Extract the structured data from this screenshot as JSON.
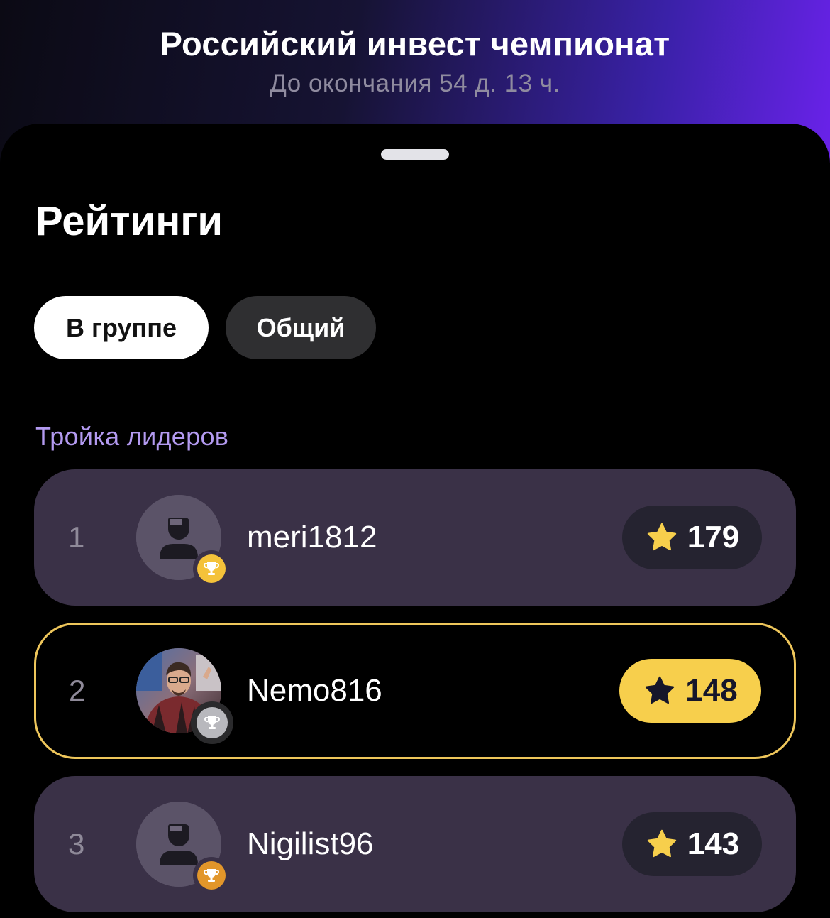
{
  "header": {
    "title": "Российский инвест чемпионат",
    "subtitle": "До окончания 54 д. 13 ч."
  },
  "sheet": {
    "title": "Рейтинги",
    "tabs": [
      {
        "label": "В группе",
        "active": true
      },
      {
        "label": "Общий",
        "active": false
      }
    ],
    "leaders_label": "Тройка лидеров",
    "leaders": [
      {
        "rank": "1",
        "username": "meri1812",
        "score": "179",
        "medal": "gold-trophy-icon",
        "avatar": "default-avatar-icon",
        "highlighted": false
      },
      {
        "rank": "2",
        "username": "Nemo816",
        "score": "148",
        "medal": "silver-trophy-icon",
        "avatar": "user-photo",
        "highlighted": true
      },
      {
        "rank": "3",
        "username": "Nigilist96",
        "score": "143",
        "medal": "bronze-trophy-icon",
        "avatar": "default-avatar-icon",
        "highlighted": false
      }
    ]
  },
  "colors": {
    "accent_purple": "#6a22ea",
    "leaders_label": "#b39af0",
    "row_background": "#3a3147",
    "highlight_border": "#eec65b",
    "star_gold": "#f7cf4c",
    "gold_medal": "#f4c23a",
    "silver_medal": "#b8b8bd",
    "bronze_medal": "#e2962a"
  }
}
